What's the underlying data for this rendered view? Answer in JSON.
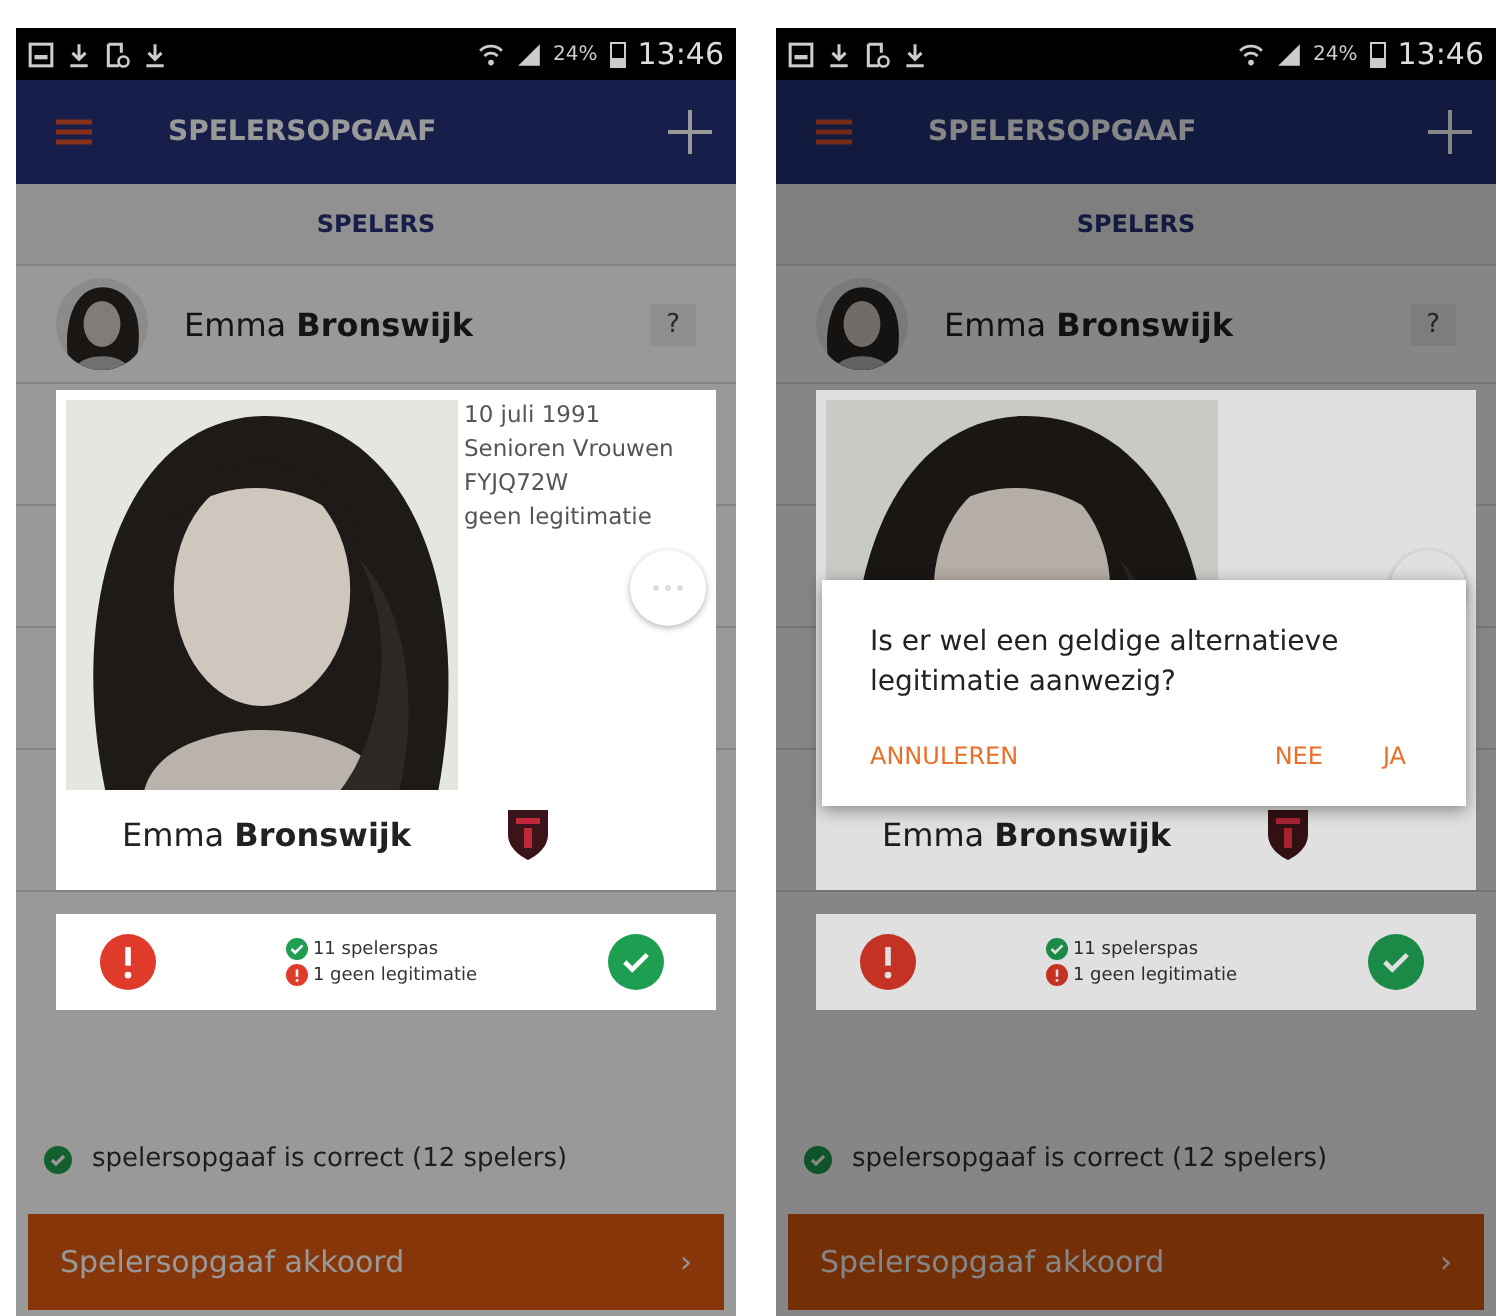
{
  "screens": [
    {
      "status_bar": {
        "battery": "24%",
        "time": "13:46"
      },
      "app_bar": {
        "title": "SPELERSOPGAAF"
      },
      "tab": "SPELERS",
      "players": [
        {
          "first": "Emma",
          "last": "Bronswijk",
          "badge": "?"
        }
      ],
      "player_card": {
        "kind": "picture",
        "first": "Emma",
        "last": "Bronswijk",
        "details": [
          "10 juli 1991",
          "Senioren Vrouwen",
          "FYJQ72W",
          "geen legitimatie"
        ]
      },
      "summary": [
        {
          "kind": "ok",
          "text": "11 spelerspas"
        },
        {
          "kind": "error",
          "text": "1 geen legitimatie"
        }
      ],
      "footer": {
        "status": "spelersopgaaf is correct (12 spelers)",
        "button": "Spelersopgaaf akkoord",
        "chevron": "›"
      }
    },
    {
      "status_bar": {
        "battery": "24%",
        "time": "13:46"
      },
      "app_bar": {
        "title": "SPELERSOPGAAF"
      },
      "tab": "SPELERS",
      "players": [
        {
          "first": "Emma",
          "last": "Bronswijk",
          "badge": "?"
        }
      ],
      "player_card": {
        "kind": "picture",
        "first": "Emma",
        "last": "Bronswijk"
      },
      "summary": [
        {
          "kind": "ok",
          "text": "11 spelerspas"
        },
        {
          "kind": "error",
          "text": "1 geen legitimatie"
        }
      ],
      "footer": {
        "status": "spelersopgaaf is correct (12 spelers)",
        "button": "Spelersopgaaf akkoord",
        "chevron": "›"
      },
      "dialog": {
        "message": "Is er wel een geldige alternatieve legitimatie aanwezig?",
        "actions": [
          "ANNULEREN",
          "NEE",
          "JA"
        ]
      }
    }
  ]
}
